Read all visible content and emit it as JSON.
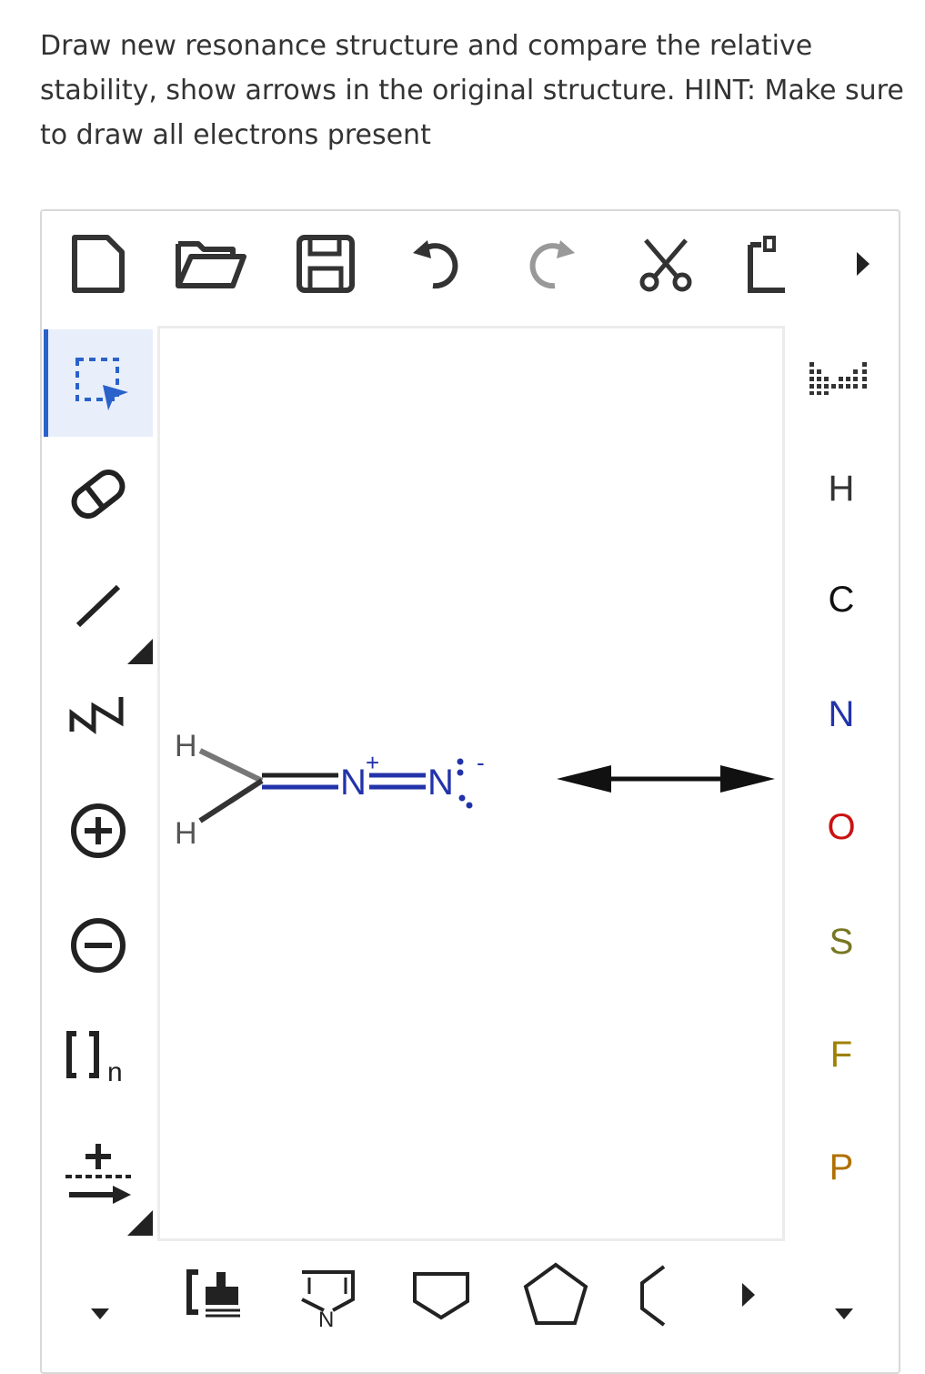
{
  "question": "Draw new resonance structure and compare the relative stability, show arrows in the original structure. HINT: Make sure to draw all electrons present",
  "toolbar": {
    "items": [
      "new-file-icon",
      "open-folder-icon",
      "save-icon",
      "undo-icon",
      "redo-icon",
      "cut-icon",
      "paste-icon",
      "more-icon"
    ]
  },
  "left_tools": {
    "items": [
      "select-icon",
      "eraser-icon",
      "bond-icon",
      "chain-icon",
      "plus-charge-icon",
      "minus-charge-icon",
      "bracket-icon",
      "reaction-arrow-icon"
    ],
    "bracket_suffix": "n",
    "selected": "select-icon"
  },
  "canvas": {
    "molecule": {
      "h_top": "H",
      "h_bottom": "H",
      "n1": "N",
      "n1_charge": "+",
      "n2": "N",
      "n2_charge": "-"
    },
    "resonance_arrow": "double-headed"
  },
  "elements": {
    "items": [
      {
        "symbol": "H",
        "color": "#333333"
      },
      {
        "symbol": "C",
        "color": "#111111"
      },
      {
        "symbol": "N",
        "color": "#2233aa"
      },
      {
        "symbol": "O",
        "color": "#cc1111"
      },
      {
        "symbol": "S",
        "color": "#777722"
      },
      {
        "symbol": "F",
        "color": "#a08000"
      },
      {
        "symbol": "P",
        "color": "#b07000"
      }
    ]
  },
  "bottom_tools": {
    "n_label": "N",
    "items": [
      "template-icon",
      "nitrogen-ring-icon",
      "square-ring-icon",
      "pentagon-ring-icon",
      "chain-ring-icon"
    ]
  },
  "colors": {
    "accent": "#2a62c9",
    "selected_bg": "#e8effa",
    "nitrogen": "#2233aa"
  }
}
